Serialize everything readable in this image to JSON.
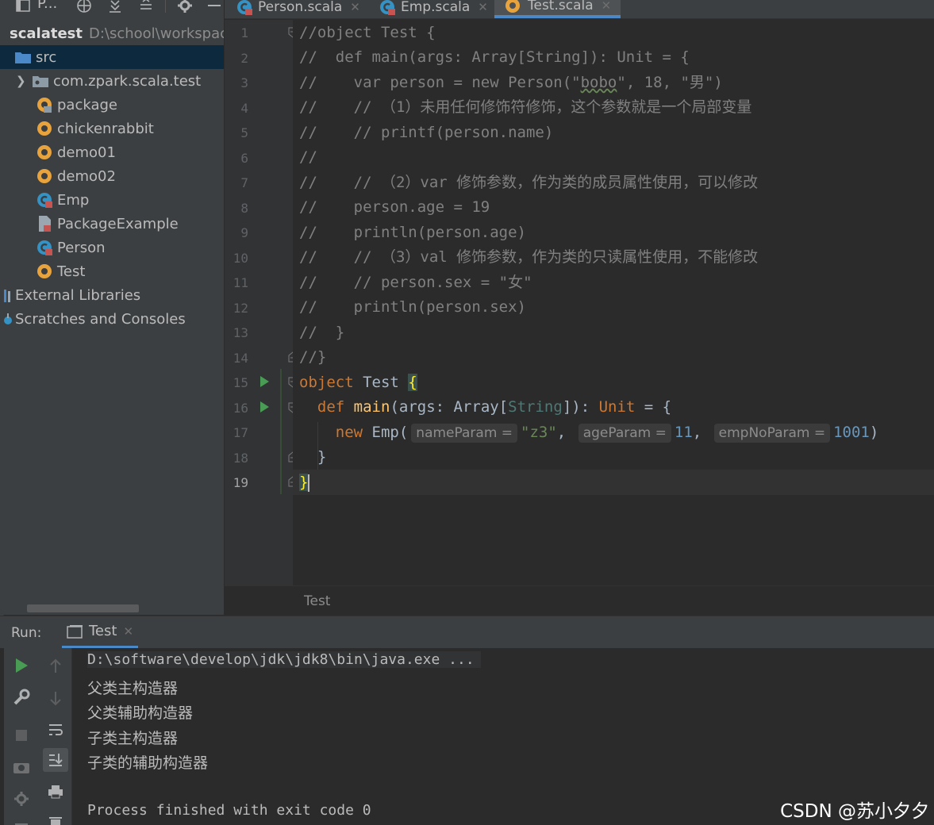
{
  "project": {
    "pane_title": "P...",
    "root_name": "scalatest",
    "root_path": "D:\\school\\workspace",
    "items": [
      {
        "label": "src",
        "kind": "folder"
      },
      {
        "label": "com.zpark.scala.test",
        "kind": "package"
      },
      {
        "label": "package",
        "kind": "package-object"
      },
      {
        "label": "chickenrabbit",
        "kind": "object"
      },
      {
        "label": "demo01",
        "kind": "object"
      },
      {
        "label": "demo02",
        "kind": "object"
      },
      {
        "label": "Emp",
        "kind": "class"
      },
      {
        "label": "PackageExample",
        "kind": "file"
      },
      {
        "label": "Person",
        "kind": "class"
      },
      {
        "label": "Test",
        "kind": "object"
      }
    ],
    "external_libraries": "External Libraries",
    "scratches": "Scratches and Consoles"
  },
  "tabs": [
    {
      "label": "Person.scala",
      "icon": "scala-class-icon",
      "active": false
    },
    {
      "label": "Emp.scala",
      "icon": "scala-class-icon",
      "active": false
    },
    {
      "label": "Test.scala",
      "icon": "scala-object-icon",
      "active": true
    }
  ],
  "editor": {
    "line_numbers": [
      "1",
      "2",
      "3",
      "4",
      "5",
      "6",
      "7",
      "8",
      "9",
      "10",
      "11",
      "12",
      "13",
      "14",
      "15",
      "16",
      "17",
      "18",
      "19"
    ],
    "current_line": 19,
    "lines": {
      "l1": "//object Test {",
      "l2": "//  def main(args: Array[String]): Unit = {",
      "l3a": "//    var person = new Person(\"",
      "l3b": "bobo",
      "l3c": "\", 18, \"男\")",
      "l4": "//    // （1）未用任何修饰符修饰，这个参数就是一个局部变量",
      "l5": "//    // printf(person.name)",
      "l6": "//",
      "l7": "//    // （2）var 修饰参数，作为类的成员属性使用，可以修改",
      "l8": "//    person.age = 19",
      "l9": "//    println(person.age)",
      "l10": "//    // （3）val 修饰参数，作为类的只读属性使用，不能修改",
      "l11": "//    // person.sex = \"女\"",
      "l12": "//    println(person.sex)",
      "l13": "//  }",
      "l14": "//}"
    },
    "code": {
      "kw_object": "object",
      "name_test": "Test",
      "brace_open": "{",
      "kw_def": "def",
      "fn_main": "main",
      "args": "(args: ",
      "type_array": "Array",
      "lbr": "[",
      "type_string": "String",
      "rbr": "]): ",
      "type_unit": "Unit",
      "eq_brace": " = {",
      "kw_new": "new",
      "emp": " Emp(",
      "hint_name": "nameParam =",
      "str_z3": "\"z3\"",
      "comma": ", ",
      "hint_age": "ageParam =",
      "num_11": "11",
      "hint_emp": "empNoParam =",
      "num_1001": "1001",
      "rparen": ")",
      "brace_close": "}",
      "brace_close_hl": "}"
    },
    "breadcrumb": "Test"
  },
  "run": {
    "label": "Run:",
    "tab": "Test",
    "output": [
      "D:\\software\\develop\\jdk\\jdk8\\bin\\java.exe ...",
      "父类主构造器",
      "父类辅助构造器",
      "子类主构造器",
      "子类的辅助构造器",
      "",
      "Process finished with exit code 0"
    ]
  },
  "watermark": "CSDN @苏小夕夕"
}
